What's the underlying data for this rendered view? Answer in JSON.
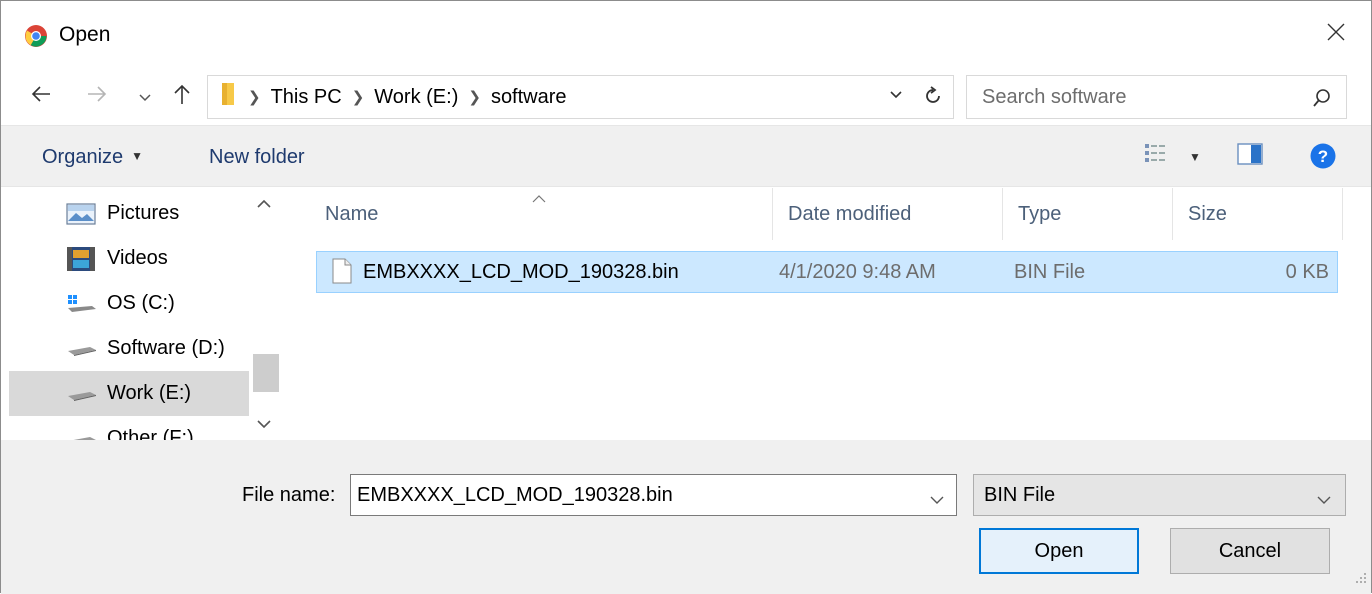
{
  "window": {
    "title": "Open",
    "close_icon": "close-icon",
    "app_icon": "chrome-icon"
  },
  "address": {
    "crumbs": [
      "This PC",
      "Work (E:)",
      "software"
    ],
    "search_placeholder": "Search software"
  },
  "toolbar": {
    "organize": "Organize",
    "new_folder": "New folder"
  },
  "nav": {
    "items": [
      {
        "label": "Pictures",
        "icon": "pictures-icon"
      },
      {
        "label": "Videos",
        "icon": "videos-icon"
      },
      {
        "label": "OS (C:)",
        "icon": "windows-drive-icon"
      },
      {
        "label": "Software (D:)",
        "icon": "drive-icon"
      },
      {
        "label": "Work (E:)",
        "icon": "drive-icon",
        "selected": true
      },
      {
        "label": "Other (F:)",
        "icon": "drive-icon"
      }
    ]
  },
  "columns": {
    "name": "Name",
    "date": "Date modified",
    "type": "Type",
    "size": "Size"
  },
  "files": [
    {
      "name": "EMBXXXX_LCD_MOD_190328.bin",
      "date": "4/1/2020 9:48 AM",
      "type": "BIN File",
      "size": "0 KB",
      "selected": true
    }
  ],
  "footer": {
    "file_name_label": "File name:",
    "file_name_value": "EMBXXXX_LCD_MOD_190328.bin",
    "file_type": "BIN File",
    "open_label": "Open",
    "cancel_label": "Cancel"
  },
  "colors": {
    "accent": "#0078d7",
    "selection": "#cce8ff",
    "help": "#1a73e8"
  }
}
